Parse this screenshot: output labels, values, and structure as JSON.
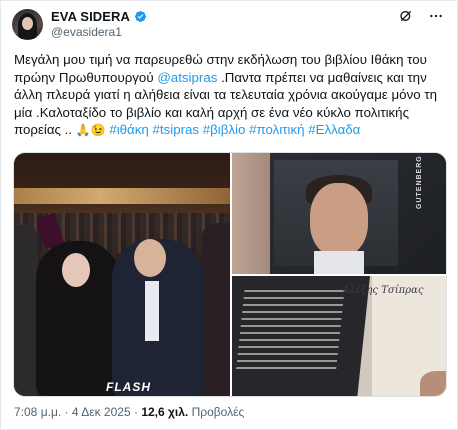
{
  "author": {
    "name": "EVA SIDERA",
    "handle": "@evasidera1"
  },
  "post": {
    "text_part1": "Μεγάλη μου τιμή να παρευρεθώ στην εκδήλωση του βιβλίου Ιθάκη του πρώην Πρωθυπουργού ",
    "mention": "@atsipras",
    "text_part2": " .Παντα πρέπει να μαθαίνεις και την άλλη πλευρά γιατί η αλήθεια είναι τα τελευταία χρόνια ακούγαμε μόνο τη μία .Καλοταξίδο το βιβλίο και καλή αρχή σε ένα νέο κύκλο πολιτικής πορείας ..",
    "emojis": "🙏😉",
    "hashtags": [
      "#ιθάκη",
      "#tsipras",
      "#βιβλίο",
      "#πολιτική",
      "#Ελλαδα"
    ]
  },
  "media": {
    "watermark": "FLASH",
    "book_spine": "GUTENBERG",
    "signature": "Αλέξης Τσίπρας"
  },
  "meta": {
    "time": "7:08 μ.μ.",
    "separator": "·",
    "date": "4 Δεκ 2025",
    "views_count": "12,6 χιλ.",
    "views_label": "Προβολές"
  },
  "colors": {
    "link": "#1d9bf0",
    "secondary_text": "#536471",
    "verified": "#1d9bf0"
  },
  "icons": [
    "verified-badge-icon",
    "grok-icon",
    "more-icon"
  ]
}
